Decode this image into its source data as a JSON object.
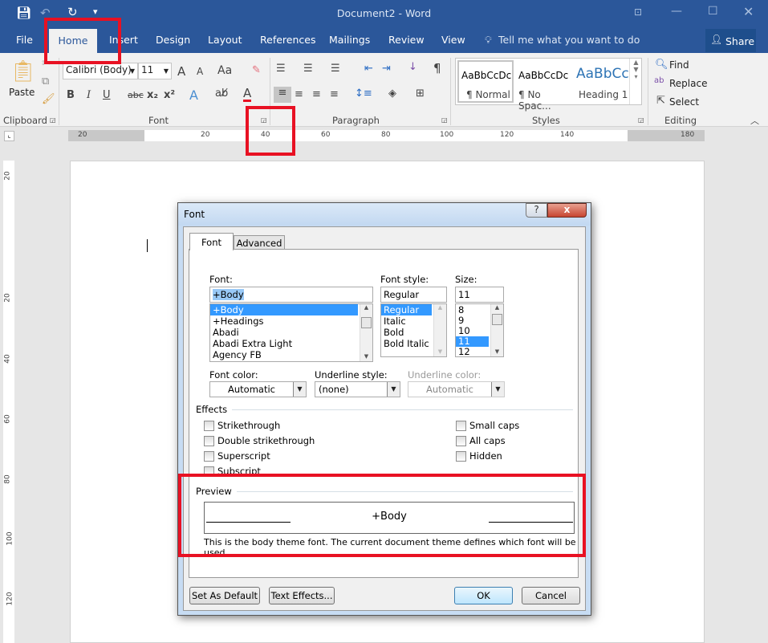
{
  "window": {
    "title": "Document2  -  Word"
  },
  "quick_access": {
    "save": "save-icon",
    "undo": "undo-icon",
    "redo": "redo-icon",
    "customize": "customize-icon"
  },
  "ribbon_tabs": [
    "File",
    "Home",
    "Insert",
    "Design",
    "Layout",
    "References",
    "Mailings",
    "Review",
    "View"
  ],
  "active_tab": "Home",
  "tell_me": "Tell me what you want to do",
  "share": "Share",
  "clipboard": {
    "paste": "Paste",
    "group": "Clipboard"
  },
  "font_group": {
    "font_name": "Calibri (Body)",
    "font_size": "11",
    "group": "Font",
    "bold": "B",
    "italic": "I",
    "underline": "U",
    "strike": "abc",
    "sub": "x₂",
    "sup": "x²",
    "grow": "A",
    "shrink": "A",
    "case": "Aa",
    "color": "A",
    "font_color_accent": "#e81123"
  },
  "paragraph_group": {
    "group": "Paragraph",
    "pilcrow": "¶"
  },
  "styles": {
    "group": "Styles",
    "items": [
      {
        "preview": "AaBbCcDc",
        "name": "¶ Normal"
      },
      {
        "preview": "AaBbCcDc",
        "name": "¶ No Spac..."
      },
      {
        "preview": "AaBbCc",
        "name": "Heading 1"
      }
    ]
  },
  "editing": {
    "group": "Editing",
    "find": "Find",
    "replace": "Replace",
    "select": "Select"
  },
  "ruler": {
    "h": [
      "20",
      "20",
      "40",
      "60",
      "80",
      "100",
      "120",
      "140",
      "180"
    ],
    "v": [
      "20",
      "20",
      "40",
      "60",
      "80",
      "100",
      "120"
    ]
  },
  "dialog": {
    "title": "Font",
    "help": "?",
    "close": "x",
    "tabs": [
      "Font",
      "Advanced"
    ],
    "font_label": "Font:",
    "font_value": "+Body",
    "font_list": [
      "+Body",
      "+Headings",
      "Abadi",
      "Abadi Extra Light",
      "Agency FB"
    ],
    "style_label": "Font style:",
    "style_value": "Regular",
    "style_list": [
      "Regular",
      "Italic",
      "Bold",
      "Bold Italic"
    ],
    "size_label": "Size:",
    "size_value": "11",
    "size_list": [
      "8",
      "9",
      "10",
      "11",
      "12"
    ],
    "font_color_label": "Font color:",
    "font_color_value": "Automatic",
    "underline_style_label": "Underline style:",
    "underline_style_value": "(none)",
    "underline_color_label": "Underline color:",
    "underline_color_value": "Automatic",
    "effects_label": "Effects",
    "effects_left": [
      "Strikethrough",
      "Double strikethrough",
      "Superscript",
      "Subscript"
    ],
    "effects_right": [
      "Small caps",
      "All caps",
      "Hidden"
    ],
    "preview_label": "Preview",
    "preview_text": "+Body",
    "preview_note": "This is the body theme font. The current document theme defines which font will be used.",
    "buttons": {
      "set_default": "Set As Default",
      "text_effects": "Text Effects...",
      "ok": "OK",
      "cancel": "Cancel"
    }
  },
  "highlight_color": "#e81123"
}
